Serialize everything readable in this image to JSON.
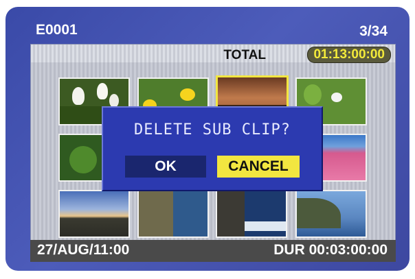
{
  "header": {
    "clip_id": "E0001",
    "counter": "3/34"
  },
  "total": {
    "label": "TOTAL",
    "time": "01:13:00:00"
  },
  "thumbnails": [
    {
      "name": "calla-lilies",
      "selected": false
    },
    {
      "name": "yellow-flowers",
      "selected": false
    },
    {
      "name": "sunset-lake",
      "selected": true
    },
    {
      "name": "green-leaves-white-flower",
      "selected": false
    },
    {
      "name": "green-plant",
      "selected": false
    },
    {
      "name": "hidden-thumb-6",
      "selected": false
    },
    {
      "name": "hidden-thumb-7",
      "selected": false
    },
    {
      "name": "pink-flower-field",
      "selected": false
    },
    {
      "name": "sunset-road",
      "selected": false
    },
    {
      "name": "rocky-coast",
      "selected": false
    },
    {
      "name": "sea-cliff-waves",
      "selected": false
    },
    {
      "name": "coastal-mountain",
      "selected": false
    }
  ],
  "dialog": {
    "message": "DELETE SUB CLIP?",
    "ok_label": "OK",
    "cancel_label": "CANCEL",
    "focused": "cancel"
  },
  "status_bar": {
    "date": "27/AUG/11:00",
    "duration": "DUR 00:03:00:00"
  },
  "colors": {
    "background": "#4450b0",
    "highlight": "#f2e640",
    "dialog": "#2c3ab0",
    "status_bar": "#4a4a4a"
  }
}
